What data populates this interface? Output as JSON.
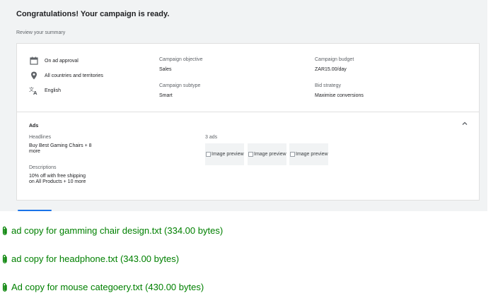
{
  "header": {
    "title": "Congratulations! Your campaign is ready.",
    "subtitle": "Review your summary"
  },
  "summary": {
    "schedule": "On ad approval",
    "location": "All countries and territories",
    "language": "English",
    "objective_label": "Campaign objective",
    "objective_value": "Sales",
    "subtype_label": "Campaign subtype",
    "subtype_value": "Smart",
    "budget_label": "Campaign budget",
    "budget_value": "ZAR15.00/day",
    "bid_label": "Bid strategy",
    "bid_value": "Maximise conversions"
  },
  "ads": {
    "title": "Ads",
    "headlines_label": "Headlines",
    "headlines_line1": "Buy Best Gaming Chairs + 8",
    "headlines_line2": "more",
    "descriptions_label": "Descriptions",
    "descriptions_line1": "10% off with free shipping",
    "descriptions_line2": "on All Products + 10 more",
    "count": "3 ads",
    "previews": [
      "Image preview",
      "Image preview",
      "Image preview"
    ]
  },
  "attachments": [
    "ad copy for gamming chair design.txt (334.00 bytes)",
    "ad copy for headphone.txt (343.00 bytes)",
    "Ad copy for mouse categoery.txt (430.00 bytes)"
  ],
  "colors": {
    "attachment_text": "#008000",
    "panel_bg": "#f1f3f4",
    "accent": "#1a73e8"
  }
}
